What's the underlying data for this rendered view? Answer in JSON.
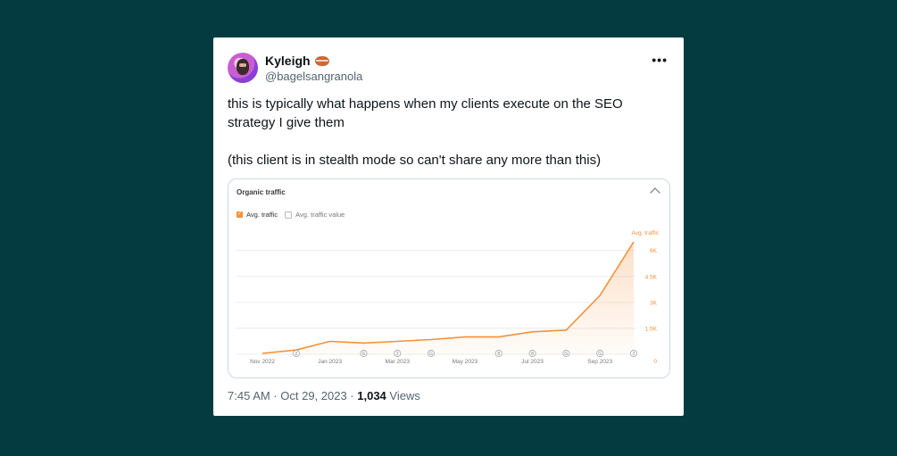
{
  "tweet": {
    "author_name": "Kyleigh",
    "author_emoji": "bagel-icon",
    "handle": "@bagelsangranola",
    "text_line1": "this is typically what happens when my clients execute on the SEO strategy I give them",
    "text_line2": "(this client is in stealth mode so can't share any more than this)",
    "time": "7:45 AM · Oct 29, 2023 · ",
    "views_count": "1,034",
    "views_label": " Views",
    "more_icon": "ellipsis-icon"
  },
  "colors": {
    "page_bg": "#033b40",
    "accent": "#f5913a"
  },
  "chart_card": {
    "title": "Organic traffic",
    "legend_on": "Avg. traffic",
    "legend_off": "Avg. traffic value",
    "axis_title": "Avg. traffic"
  },
  "chart_data": {
    "type": "area",
    "series": [
      {
        "name": "Avg. traffic",
        "x": [
          "Nov 2022",
          "Dec 2022",
          "Jan 2023",
          "Feb 2023",
          "Mar 2023",
          "Apr 2023",
          "May 2023",
          "Jun 2023",
          "Jul 2023",
          "Aug 2023",
          "Sep 2023",
          "Oct 2023"
        ],
        "values": [
          50,
          250,
          750,
          650,
          750,
          850,
          1000,
          1000,
          1300,
          1400,
          3400,
          6500
        ]
      }
    ],
    "x_tick_labels": [
      "Nov 2022",
      "Jan 2023",
      "Mar 2023",
      "May 2023",
      "Jul 2023",
      "Sep 2023"
    ],
    "y_ticks": [
      0,
      1500,
      3000,
      4500,
      6000
    ],
    "y_tick_labels": [
      "0",
      "1.5K",
      "3K",
      "4.5K",
      "6K"
    ],
    "ylim": [
      0,
      6500
    ],
    "grid": true,
    "y_axis_side": "right",
    "annotations": [
      {
        "month": "Dec 2022",
        "text": "2"
      },
      {
        "month": "Feb 2023",
        "text": "G"
      },
      {
        "month": "Mar 2023",
        "text": "2"
      },
      {
        "month": "Apr 2023",
        "text": "G"
      },
      {
        "month": "Jun 2023",
        "text": "8"
      },
      {
        "month": "Jul 2023",
        "text": "8"
      },
      {
        "month": "Aug 2023",
        "text": "G"
      },
      {
        "month": "Sep 2023",
        "text": "G"
      },
      {
        "month": "Oct 2023",
        "text": "2"
      }
    ]
  }
}
